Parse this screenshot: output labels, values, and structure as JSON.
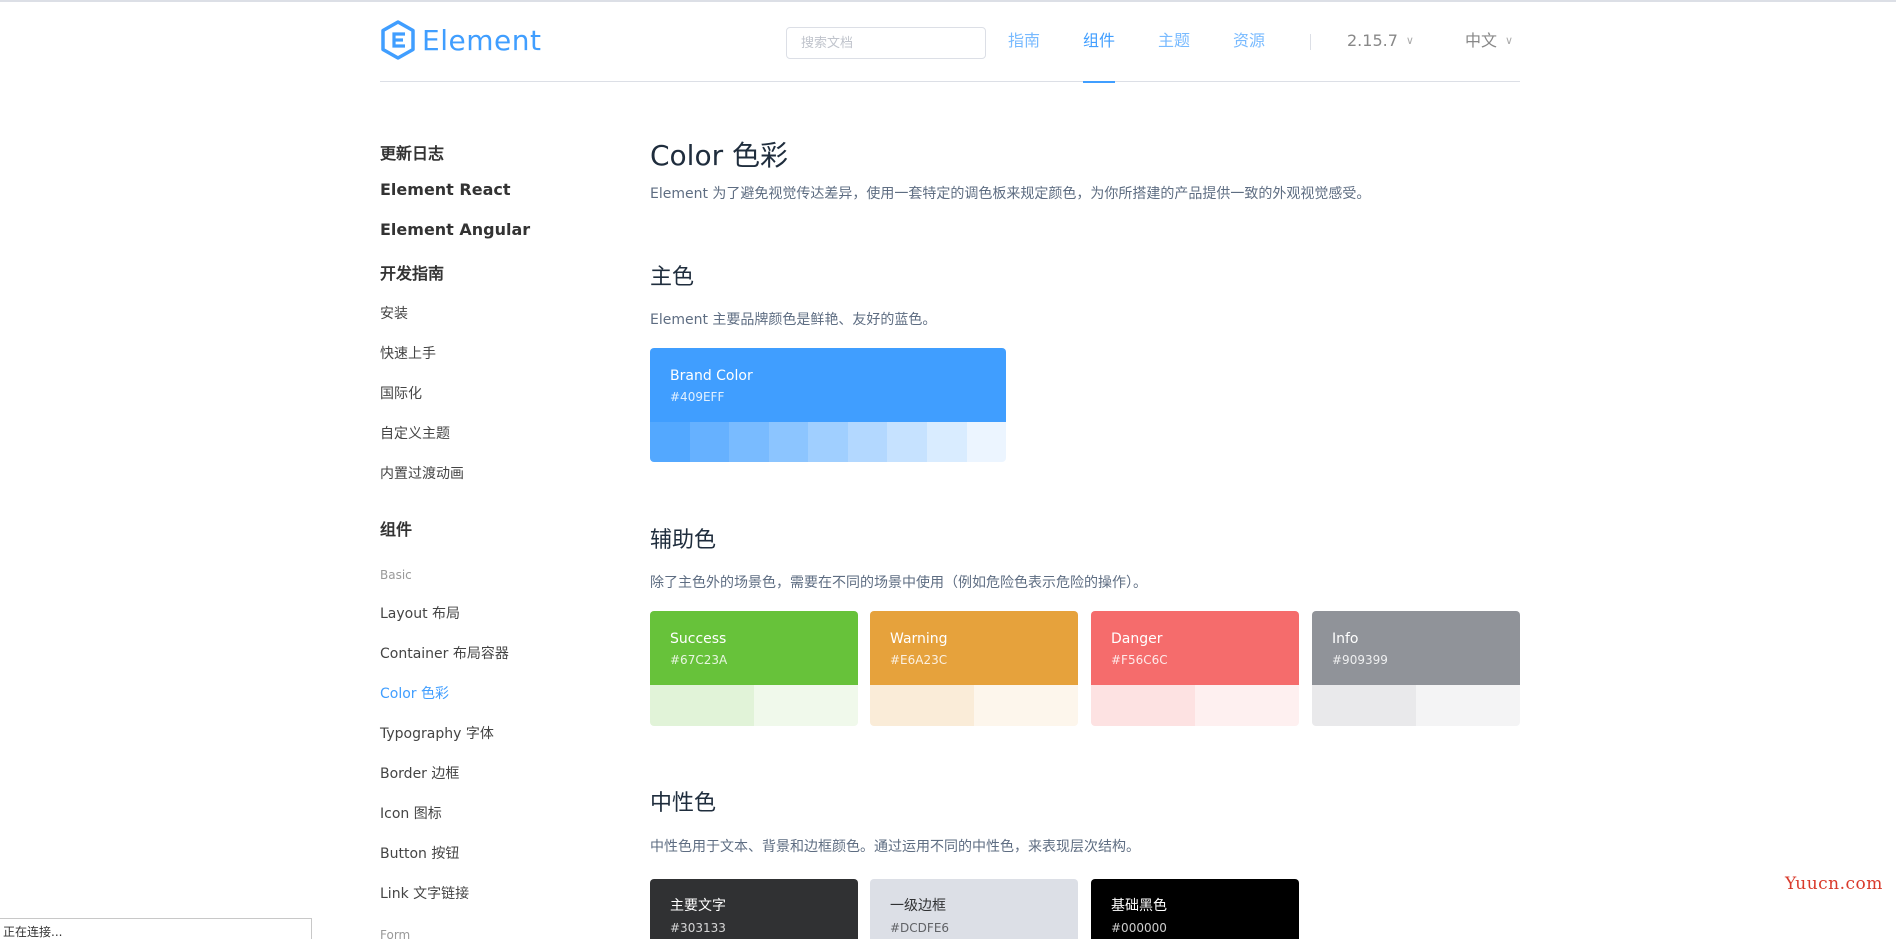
{
  "header": {
    "logo_text": "Element",
    "search_placeholder": "搜索文档",
    "nav": [
      {
        "label": "指南",
        "active": false
      },
      {
        "label": "组件",
        "active": true
      },
      {
        "label": "主题",
        "active": false
      },
      {
        "label": "资源",
        "active": false
      }
    ],
    "version": "2.15.7",
    "language": "中文"
  },
  "sidebar": {
    "changelog": "更新日志",
    "react": "Element React",
    "angular": "Element Angular",
    "guide_group": "开发指南",
    "guide_items": [
      "安装",
      "快速上手",
      "国际化",
      "自定义主题",
      "内置过渡动画"
    ],
    "components_group": "组件",
    "basic_category": "Basic",
    "basic_items": [
      "Layout 布局",
      "Container 布局容器",
      "Color 色彩",
      "Typography 字体",
      "Border 边框",
      "Icon 图标",
      "Button 按钮",
      "Link 文字链接"
    ],
    "active_item": "Color 色彩",
    "form_category": "Form"
  },
  "content": {
    "title": "Color 色彩",
    "intro": "Element 为了避免视觉传达差异，使用一套特定的调色板来规定颜色，为你所搭建的产品提供一致的外观视觉感受。",
    "primary_heading": "主色",
    "primary_desc": "Element 主要品牌颜色是鲜艳、友好的蓝色。",
    "brand": {
      "name": "Brand Color",
      "hex": "#409EFF",
      "shades": [
        "#53a8ff",
        "#66b1ff",
        "#79bbff",
        "#8cc5ff",
        "#a0cfff",
        "#b3d8ff",
        "#c6e2ff",
        "#d9ecff",
        "#ecf5ff"
      ]
    },
    "secondary_heading": "辅助色",
    "secondary_desc": "除了主色外的场景色，需要在不同的场景中使用（例如危险色表示危险的操作）。",
    "secondary": [
      {
        "name": "Success",
        "hex": "#67C23A",
        "light": [
          "#e1f3d8",
          "#f0f9eb"
        ]
      },
      {
        "name": "Warning",
        "hex": "#E6A23C",
        "light": [
          "#faecd8",
          "#fdf6ec"
        ]
      },
      {
        "name": "Danger",
        "hex": "#F56C6C",
        "light": [
          "#fde2e2",
          "#fef0f0"
        ]
      },
      {
        "name": "Info",
        "hex": "#909399",
        "light": [
          "#e9e9eb",
          "#f4f4f5"
        ]
      }
    ],
    "neutral_heading": "中性色",
    "neutral_desc": "中性色用于文本、背景和边框颜色。通过运用不同的中性色，来表现层次结构。",
    "neutral": [
      {
        "name": "主要文字",
        "hex": "#303133"
      },
      {
        "name": "一级边框",
        "hex": "#DCDFE6"
      },
      {
        "name": "基础黑色",
        "hex": "#000000"
      }
    ]
  },
  "watermark": "Yuucn.com",
  "statusbar": "正在连接..."
}
